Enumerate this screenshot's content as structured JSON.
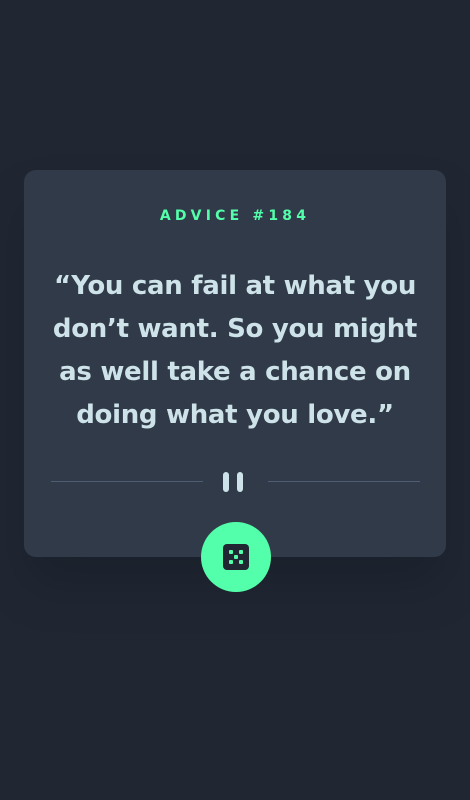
{
  "advice": {
    "label": "ADVICE #184",
    "quote": "“You can fail at what you don’t want. So you might as well take a chance on doing what you love.”"
  },
  "icons": {
    "divider": "pause-divider-icon",
    "button": "dice-icon"
  },
  "colors": {
    "background": "#202733",
    "card": "#313a48",
    "accent": "#53ffaa",
    "text": "#cee3e9",
    "divider": "#4f5d74"
  }
}
